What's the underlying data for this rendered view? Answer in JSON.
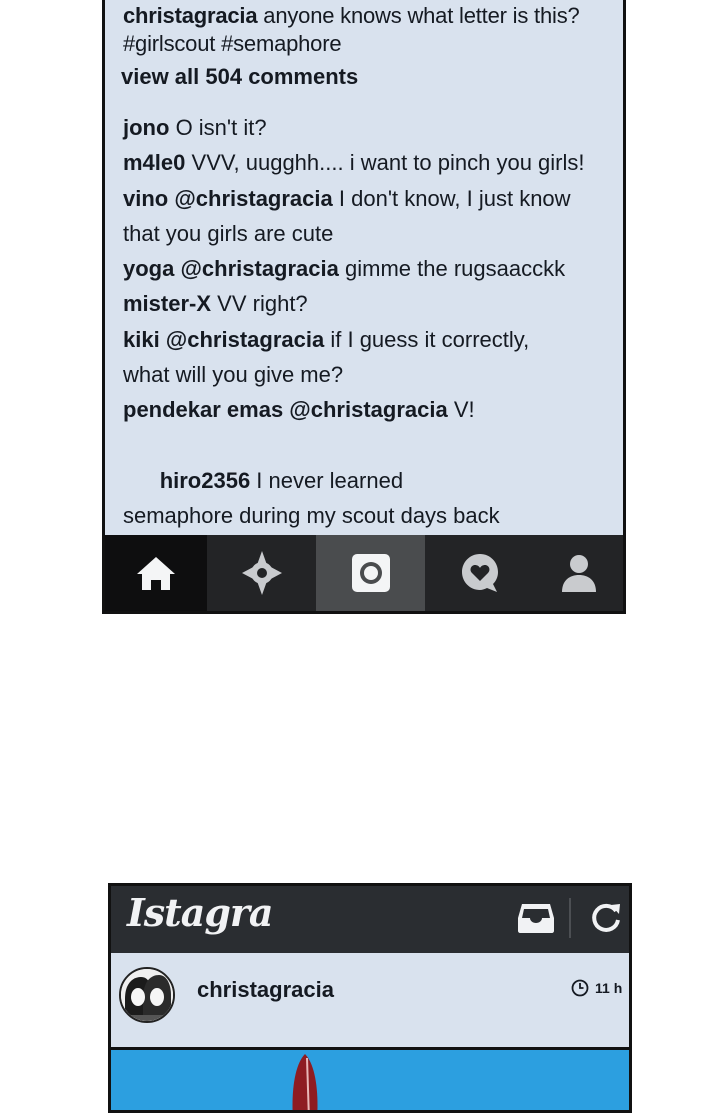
{
  "panel1": {
    "caption": {
      "user": "christagracia",
      "text": "anyone knows what letter is this?",
      "hashtags": "#girlscout #semaphore"
    },
    "view_all": "view all 504 comments",
    "comments": [
      {
        "user": "jono",
        "text": "O isn't it?"
      },
      {
        "user": "m4le0",
        "text": "VVV, uugghh.... i want to pinch you girls!"
      },
      {
        "user": "vino @christagracia",
        "text": "I don't know, I just know that you girls are cute"
      },
      {
        "user": "yoga @christagracia",
        "text": "gimme the rugsaacckk"
      },
      {
        "user": "mister-X",
        "text": "VV right?"
      },
      {
        "user": "kiki @christagracia",
        "text": "if I guess it correctly, what will you give me?"
      },
      {
        "user": "pendekar emas @christagracia",
        "text": "V!"
      },
      {
        "user": "hiro2356",
        "text": " I never learned semaphore during my scout days back then ..."
      }
    ],
    "tabbar": {
      "icons": [
        "home-icon",
        "explore-icon",
        "camera-icon",
        "news-icon",
        "profile-icon"
      ]
    }
  },
  "panel2": {
    "app_title": "Istagra",
    "post": {
      "user": "christagracia",
      "time": "11 h"
    }
  },
  "colors": {
    "panel_bg": "#d9e2ee",
    "tabbar_bg": "#232426",
    "active_tab": "#4a4c4e",
    "header_bg": "#2a2d31",
    "photo_bg": "#2c9fe0"
  }
}
